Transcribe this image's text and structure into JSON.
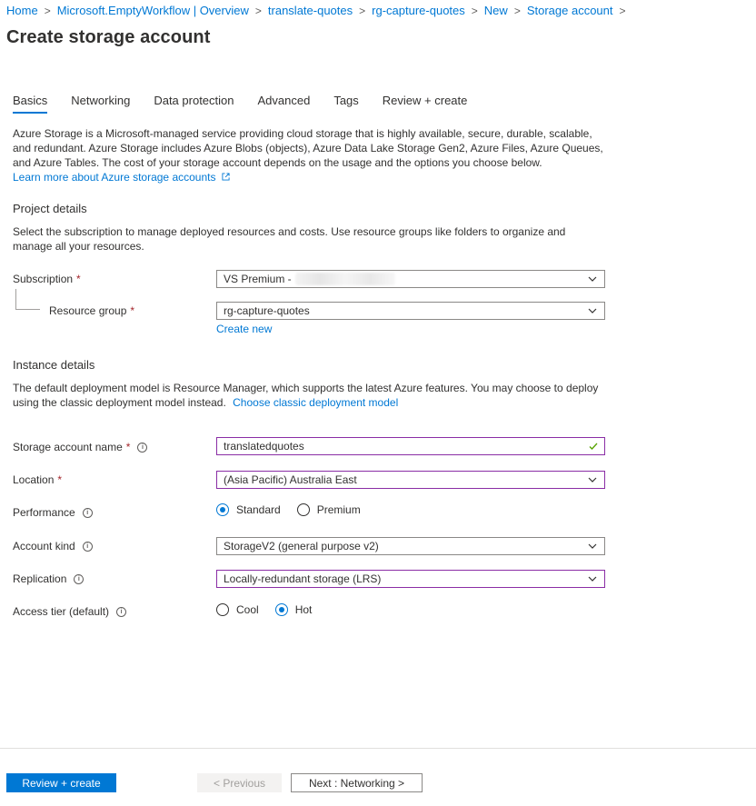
{
  "breadcrumb": [
    "Home",
    "Microsoft.EmptyWorkflow | Overview",
    "translate-quotes",
    "rg-capture-quotes",
    "New",
    "Storage account"
  ],
  "page_title": "Create storage account",
  "tabs": [
    "Basics",
    "Networking",
    "Data protection",
    "Advanced",
    "Tags",
    "Review + create"
  ],
  "intro": {
    "text": "Azure Storage is a Microsoft-managed service providing cloud storage that is highly available, secure, durable, scalable, and redundant. Azure Storage includes Azure Blobs (objects), Azure Data Lake Storage Gen2, Azure Files, Azure Queues, and Azure Tables. The cost of your storage account depends on the usage and the options you choose below.",
    "link": "Learn more about Azure storage accounts"
  },
  "project": {
    "title": "Project details",
    "desc": "Select the subscription to manage deployed resources and costs. Use resource groups like folders to organize and manage all your resources.",
    "subscription_label": "Subscription",
    "subscription_value": "VS Premium -",
    "resource_group_label": "Resource group",
    "resource_group_value": "rg-capture-quotes",
    "create_new": "Create new"
  },
  "instance": {
    "title": "Instance details",
    "desc": "The default deployment model is Resource Manager, which supports the latest Azure features. You may choose to deploy using the classic deployment model instead.",
    "classic_link": "Choose classic deployment model",
    "name_label": "Storage account name",
    "name_value": "translatedquotes",
    "location_label": "Location",
    "location_value": "(Asia Pacific) Australia East",
    "performance_label": "Performance",
    "performance_options": [
      "Standard",
      "Premium"
    ],
    "account_kind_label": "Account kind",
    "account_kind_value": "StorageV2 (general purpose v2)",
    "replication_label": "Replication",
    "replication_value": "Locally-redundant storage (LRS)",
    "access_tier_label": "Access tier (default)",
    "access_tier_options": [
      "Cool",
      "Hot"
    ]
  },
  "footer": {
    "review_create": "Review + create",
    "previous": "< Previous",
    "next": "Next : Networking >"
  },
  "colors": {
    "accent": "#0078d4",
    "required": "#a4262c",
    "focus": "#8a2da5",
    "valid": "#57a300"
  }
}
